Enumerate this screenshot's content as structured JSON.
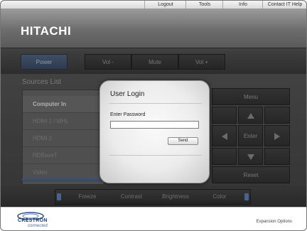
{
  "top_links": [
    "Logout",
    "Tools",
    "Info",
    "Contact IT Help"
  ],
  "brand": {
    "logo_text": "HITACHI"
  },
  "controls": {
    "power": "Power",
    "vol_minus": "Vol -",
    "mute": "Mute",
    "vol_plus": "Vol +"
  },
  "sources": {
    "title": "Sources List",
    "items": [
      "Computer In",
      "HDMI 1 / MHL",
      "HDMI 2",
      "HDBaseT",
      "Video"
    ],
    "active": "Computer In"
  },
  "keypad": {
    "menu": "Menu",
    "enter": "Enter",
    "reset": "Reset"
  },
  "adjustments": [
    "Freeze",
    "Contrast",
    "Brightness",
    "Color"
  ],
  "footer": {
    "crestron": "CRESTRON",
    "connected": "connected",
    "expansion": "Expansion Options"
  },
  "dialog": {
    "title": "User Login",
    "password_label": "Enter Password",
    "password_value": "",
    "send_label": "Send"
  },
  "colors": {
    "accent_blue": "#4b5f82",
    "dialog_bg": "#efefef"
  }
}
